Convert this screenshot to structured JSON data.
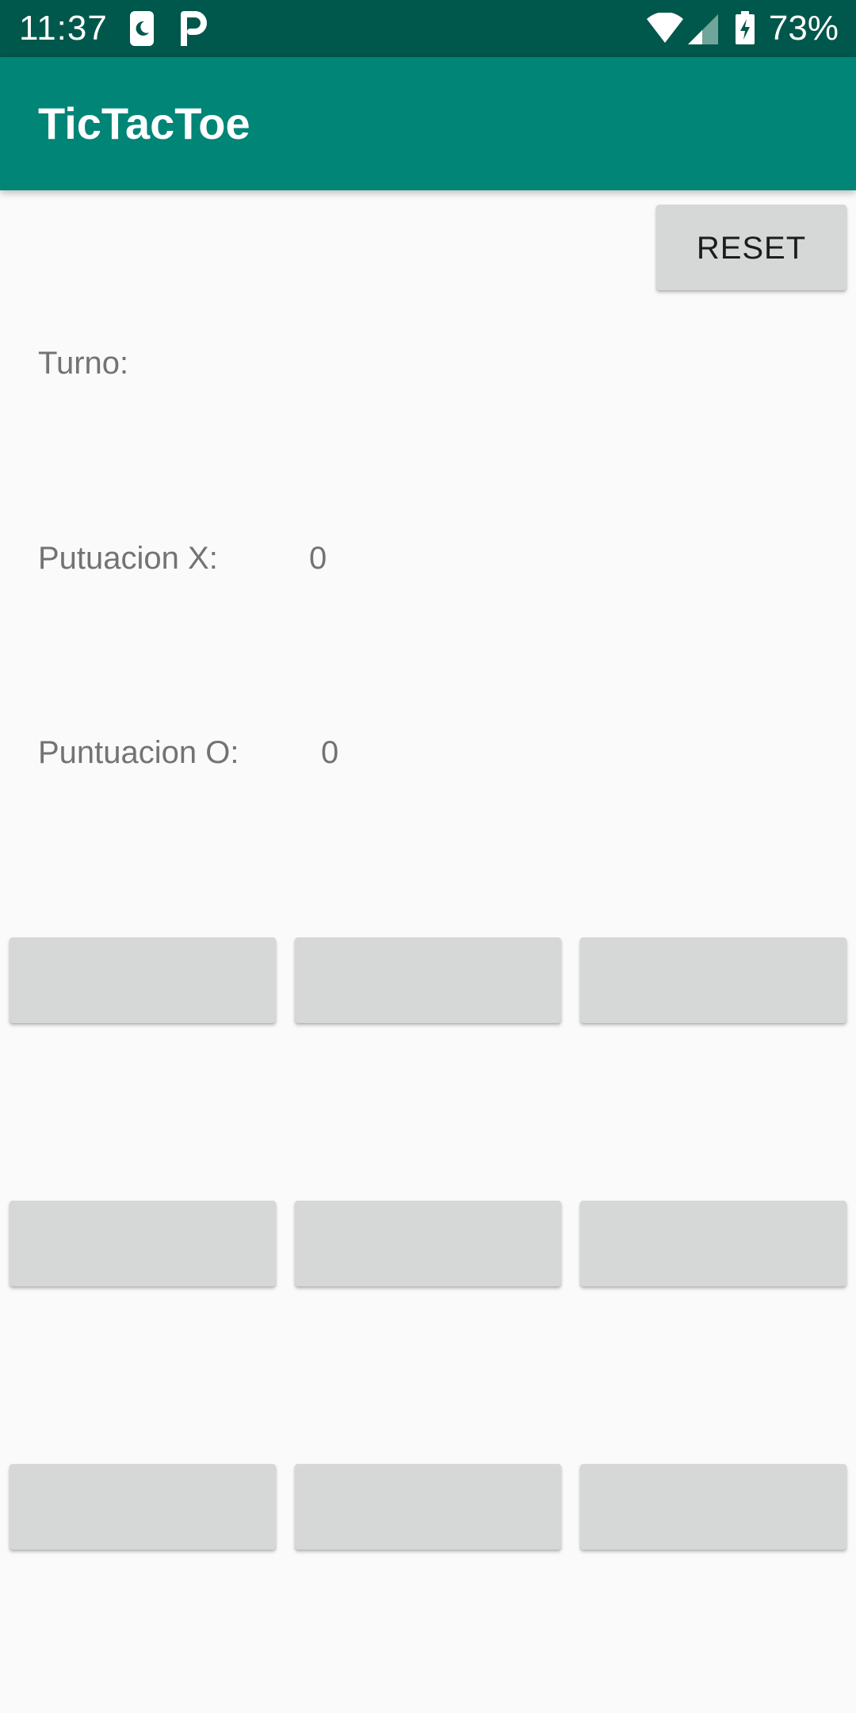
{
  "status_bar": {
    "time": "11:37",
    "battery_percent": "73%",
    "icons": [
      "do-not-disturb-night-icon",
      "parking-p-icon",
      "wifi-icon",
      "cell-signal-icon",
      "battery-charging-icon"
    ]
  },
  "app_bar": {
    "title": "TicTacToe",
    "color": "#008577",
    "status_color": "#00574b"
  },
  "controls": {
    "reset_label": "RESET"
  },
  "info": {
    "turn_label": "Turno:",
    "turn_value": "",
    "score_x_label": "Putuacion X:",
    "score_x_value": "0",
    "score_o_label": "Puntuacion O:",
    "score_o_value": "0"
  },
  "board": {
    "cells": [
      "",
      "",
      "",
      "",
      "",
      "",
      "",
      "",
      ""
    ]
  }
}
